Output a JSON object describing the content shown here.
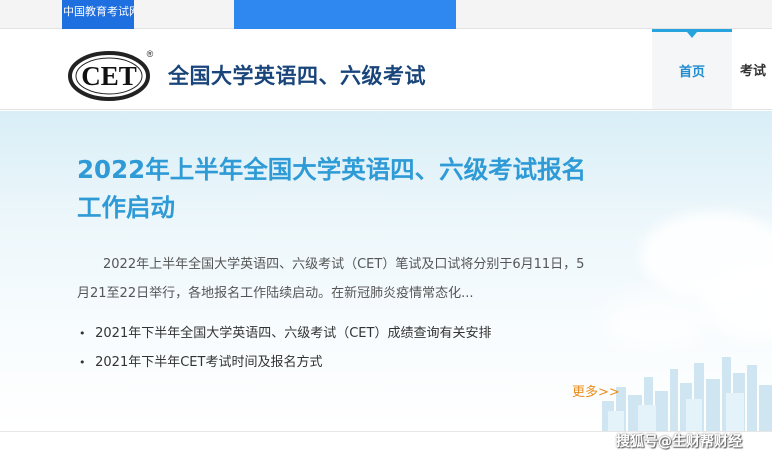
{
  "topbar": {
    "site_name": "中国教育考试网"
  },
  "header": {
    "logo_text": "CET",
    "logo_mark": "®",
    "title": "全国大学英语四、六级考试",
    "nav": [
      {
        "label": "首页"
      },
      {
        "label": "考试"
      }
    ]
  },
  "main": {
    "headline": "2022年上半年全国大学英语四、六级考试报名工作启动",
    "summary": "2022年上半年全国大学英语四、六级考试（CET）笔试及口试将分别于6月11日，5月21至22日举行，各地报名工作陆续启动。在新冠肺炎疫情常态化...",
    "news": [
      {
        "title": "2021年下半年全国大学英语四、六级考试（CET）成绩查询有关安排"
      },
      {
        "title": "2021年下半年CET考试时间及报名方式"
      }
    ],
    "bullet_glyph": "•",
    "more_label": "更多>>"
  },
  "watermark": "搜狐号@生财帮财经",
  "colors": {
    "brand_navy": "#19457b",
    "accent_blue": "#2e9ad6",
    "nav_active": "#1f8ccf",
    "more_orange": "#e98d1b",
    "topbar_blue": "#1e6fe0"
  }
}
